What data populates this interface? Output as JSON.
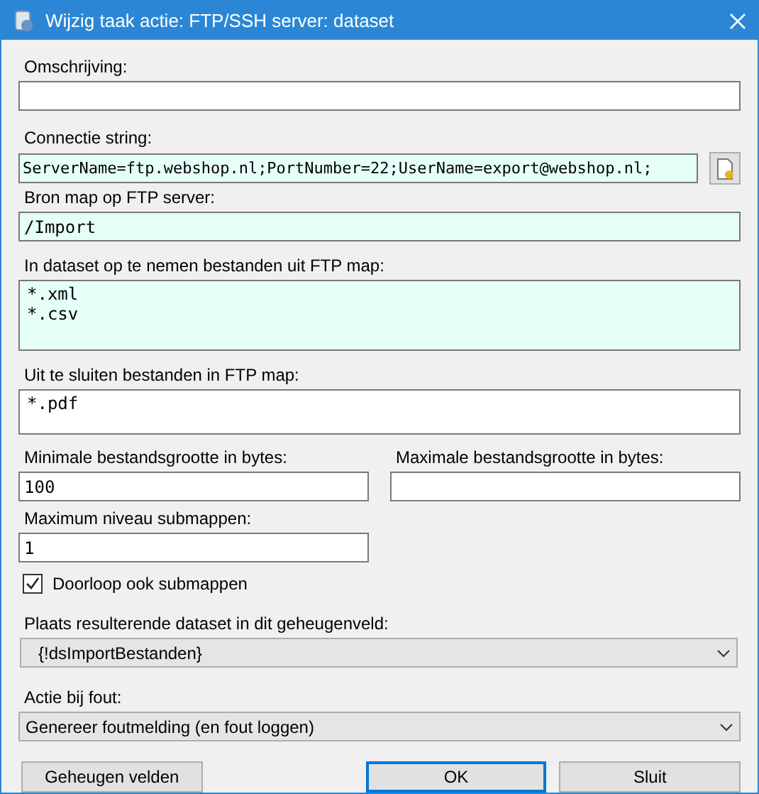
{
  "window": {
    "title": "Wijzig taak actie: FTP/SSH server: dataset"
  },
  "description": {
    "label": "Omschrijving:",
    "required": false
  },
  "connection": {
    "label": "Connectie string:",
    "value": "ServerName=ftp.webshop.nl;PortNumber=22;UserName=export@webshop.nl;",
    "required": true
  },
  "source_folder": {
    "label": "Bron map op FTP server:",
    "value": "/Import",
    "required": true
  },
  "include_files": {
    "label": "In dataset op te nemen bestanden uit FTP map:",
    "value": "*.xml\n*.csv",
    "required": true
  },
  "exclude_files": {
    "label": "Uit te sluiten bestanden in FTP map:",
    "value": "*.pdf",
    "required": false
  },
  "min_size": {
    "label": "Minimale bestandsgrootte in bytes:",
    "value": "100",
    "required": false
  },
  "max_size": {
    "label": "Maximale bestandsgrootte in bytes:",
    "required": false
  },
  "max_depth": {
    "label": "Maximum niveau submappen:",
    "value": "1",
    "required": false
  },
  "recurse": {
    "label": "Doorloop ook submappen",
    "checked": true
  },
  "target_variable": {
    "label": "Plaats resulterende dataset in dit geheugenveld:",
    "value": "{!dsImportBestanden}"
  },
  "on_error": {
    "label": "Actie bij fout:",
    "value": "Genereer foutmelding (en fout loggen)"
  },
  "buttons": [
    {
      "label": "Geheugen velden",
      "default": false
    },
    {
      "label": "OK",
      "default": true
    },
    {
      "label": "Sluit",
      "default": false
    }
  ]
}
